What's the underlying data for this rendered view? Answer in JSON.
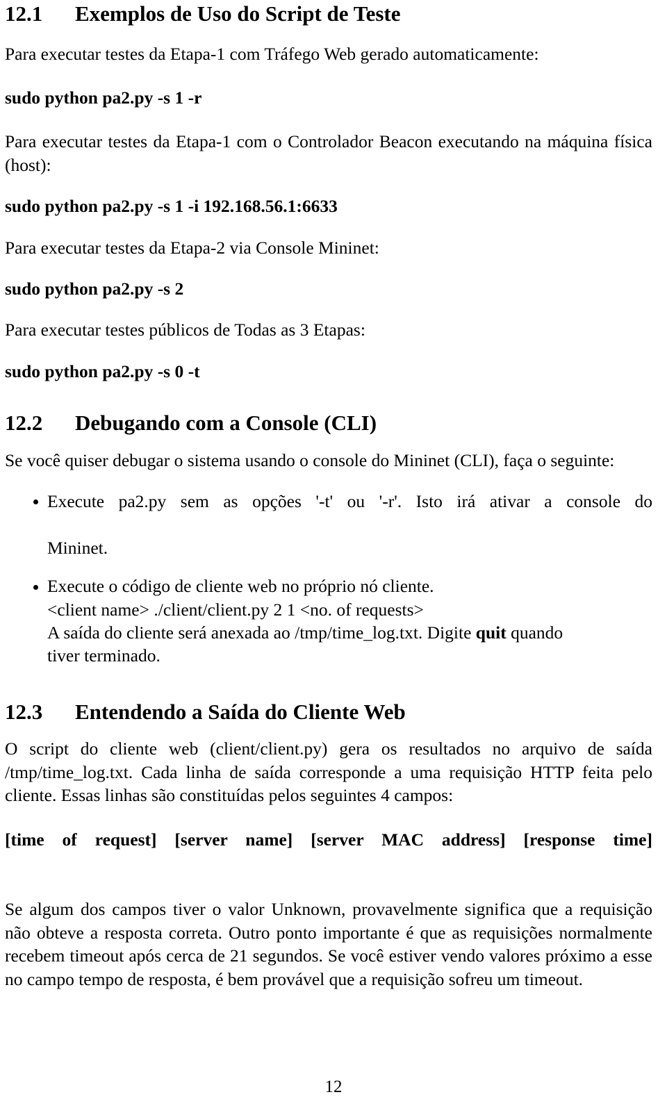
{
  "document": {
    "page_number": "12",
    "sections": [
      {
        "number": "12.1",
        "title": "Exemplos de Uso do Script de Teste"
      },
      {
        "number": "12.2",
        "title": "Debugando com a Console (CLI)"
      },
      {
        "number": "12.3",
        "title": "Entendendo a Saída do Cliente Web"
      }
    ]
  },
  "s121": {
    "intro1": "Para executar testes da Etapa-1 com Tráfego Web gerado automaticamente:",
    "cmd1": "sudo python pa2.py -s 1 -r",
    "intro2": "Para executar testes da Etapa-1 com o Controlador Beacon executando na máquina física (host):",
    "cmd2": "sudo python pa2.py -s 1 -i 192.168.56.1:6633",
    "intro3": "Para executar testes da Etapa-2 via Console Mininet:",
    "cmd3": "sudo python pa2.py -s 2",
    "intro4": "Para executar testes públicos de Todas as 3 Etapas:",
    "cmd4": "sudo python pa2.py -s 0 -t"
  },
  "s122": {
    "intro": "Se você quiser debugar o sistema usando o console do Mininet (CLI), faça o seguinte:",
    "bullet1": {
      "line1": "Execute pa2.py sem as opções '-t' ou '-r'.  Isto irá ativar a console do",
      "line2": "Mininet."
    },
    "bullet2": {
      "line1": "Execute o código de cliente web no próprio nó cliente.",
      "line2": "<client name> ./client/client.py 2 1 <no. of requests>",
      "line3_a": "A saída do cliente será anexada ao /tmp/time_log.txt.  Digite ",
      "line3_bold": "quit",
      "line3_b": " quando",
      "line4": "tiver terminado."
    }
  },
  "s123": {
    "para1": "O script do cliente web (client/client.py) gera os resultados no arquivo de saída /tmp/time_log.txt.  Cada linha de saída corresponde a uma requisição HTTP feita pelo cliente.  Essas linhas são constituídas pelos seguintes 4 campos:",
    "fields_line": "[time of request] [server name] [server MAC address] [response time]",
    "para2": "Se algum dos campos tiver o valor Unknown, provavelmente significa que a requisição não obteve a resposta correta.  Outro ponto importante é que as requisições normalmente recebem timeout após cerca de 21 segundos.  Se você estiver vendo valores próximo a esse no campo tempo de resposta, é bem provável que a requisição sofreu um timeout."
  }
}
